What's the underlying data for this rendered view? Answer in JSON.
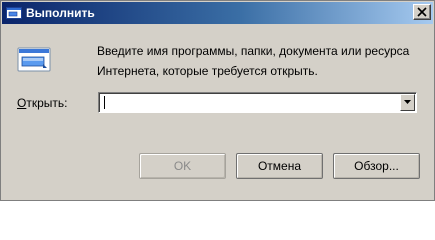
{
  "window": {
    "title": "Выполнить",
    "title_icon": "run-icon",
    "close_icon": "close-icon",
    "colors": {
      "face": "#d4d0c8",
      "title_start": "#0a246a",
      "title_end": "#a6caf0"
    }
  },
  "main": {
    "icon": "run-program-icon",
    "description_line1": "Введите имя программы, папки, документа или ресурса",
    "description_line2": "Интернета, которые требуется открыть.",
    "open_label_accel": "О",
    "open_label_rest": "ткрыть:",
    "input_value": "",
    "dropdown_icon": "chevron-down-icon"
  },
  "buttons": {
    "ok": "OK",
    "cancel": "Отмена",
    "browse": "Обзор..."
  }
}
